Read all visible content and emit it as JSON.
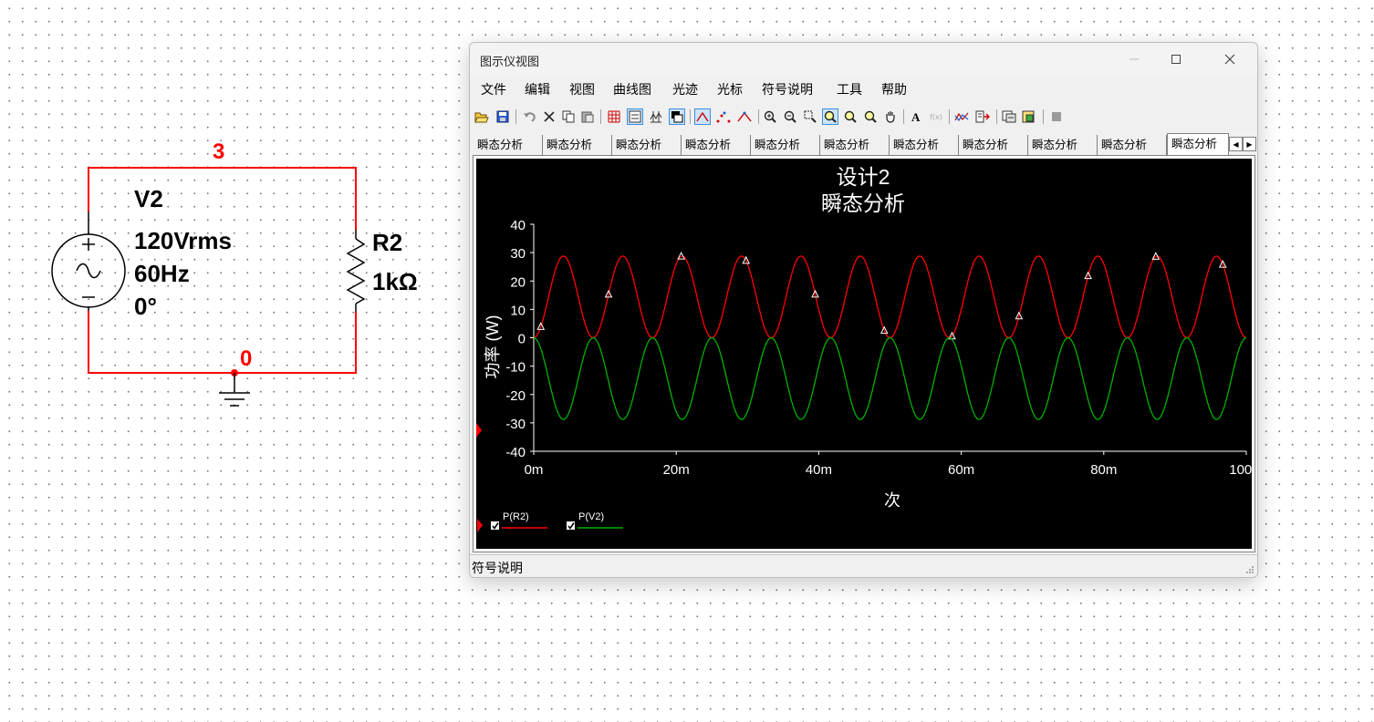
{
  "schematic": {
    "source": {
      "name": "V2",
      "voltage": "120Vrms",
      "frequency": "60Hz",
      "phase": "0°"
    },
    "resistor": {
      "name": "R2",
      "value": "1kΩ"
    },
    "nets": {
      "top": "3",
      "ground": "0"
    },
    "wire_color": "#ff0000"
  },
  "window": {
    "title": "图示仪视图",
    "menu": [
      "文件",
      "编辑",
      "视图",
      "曲线图",
      "光迹",
      "光标",
      "符号说明",
      "工具",
      "帮助"
    ],
    "tabs": [
      "瞬态分析",
      "瞬态分析",
      "瞬态分析",
      "瞬态分析",
      "瞬态分析",
      "瞬态分析",
      "瞬态分析",
      "瞬态分析",
      "瞬态分析",
      "瞬态分析",
      "瞬态分析"
    ],
    "active_tab": 10,
    "status": "符号说明",
    "toolbar_icons": [
      "open-icon",
      "save-icon",
      "undo-icon",
      "cut-icon",
      "copy-icon",
      "paste-icon",
      "grid-icon",
      "legend-icon",
      "cursor-icon",
      "reverse-colors-icon",
      "show-select-marks-icon",
      "show-data-points-icon",
      "show-markers-icon",
      "zoom-in-icon",
      "zoom-out-icon",
      "zoom-select-icon",
      "zoom-full-icon",
      "zoom-x-icon",
      "zoom-y-icon",
      "pan-icon",
      "text-icon",
      "formula-icon",
      "overlay-traces-icon",
      "export-icon",
      "copy-graph-icon",
      "paste-graph-icon",
      "stop-icon"
    ]
  },
  "chart_data": {
    "type": "line",
    "title": "设计2",
    "subtitle": "瞬态分析",
    "xlabel": "次",
    "ylabel": "功率 (W)",
    "xlim": [
      0,
      100
    ],
    "ylim": [
      -40,
      40
    ],
    "xticks": [
      "0m",
      "20m",
      "40m",
      "60m",
      "80m",
      "100m"
    ],
    "yticks": [
      "40",
      "30",
      "20",
      "10",
      "0",
      "-10",
      "-20",
      "-30",
      "-40"
    ],
    "background": "#000000",
    "grid": false,
    "legend_placement": "bottom-left",
    "series": [
      {
        "name": "P(R2)",
        "color": "#ff0000",
        "amplitude": 28.8,
        "frequency_hz": 60,
        "sign": 1,
        "checked": true,
        "markers_x": [
          1,
          10.5,
          20.7,
          29.8,
          39.5,
          49.2,
          58.7,
          68.1,
          77.8,
          87.3,
          96.7
        ]
      },
      {
        "name": "P(V2)",
        "color": "#00b000",
        "amplitude": 28.8,
        "frequency_hz": 60,
        "sign": -1,
        "checked": true
      }
    ]
  }
}
